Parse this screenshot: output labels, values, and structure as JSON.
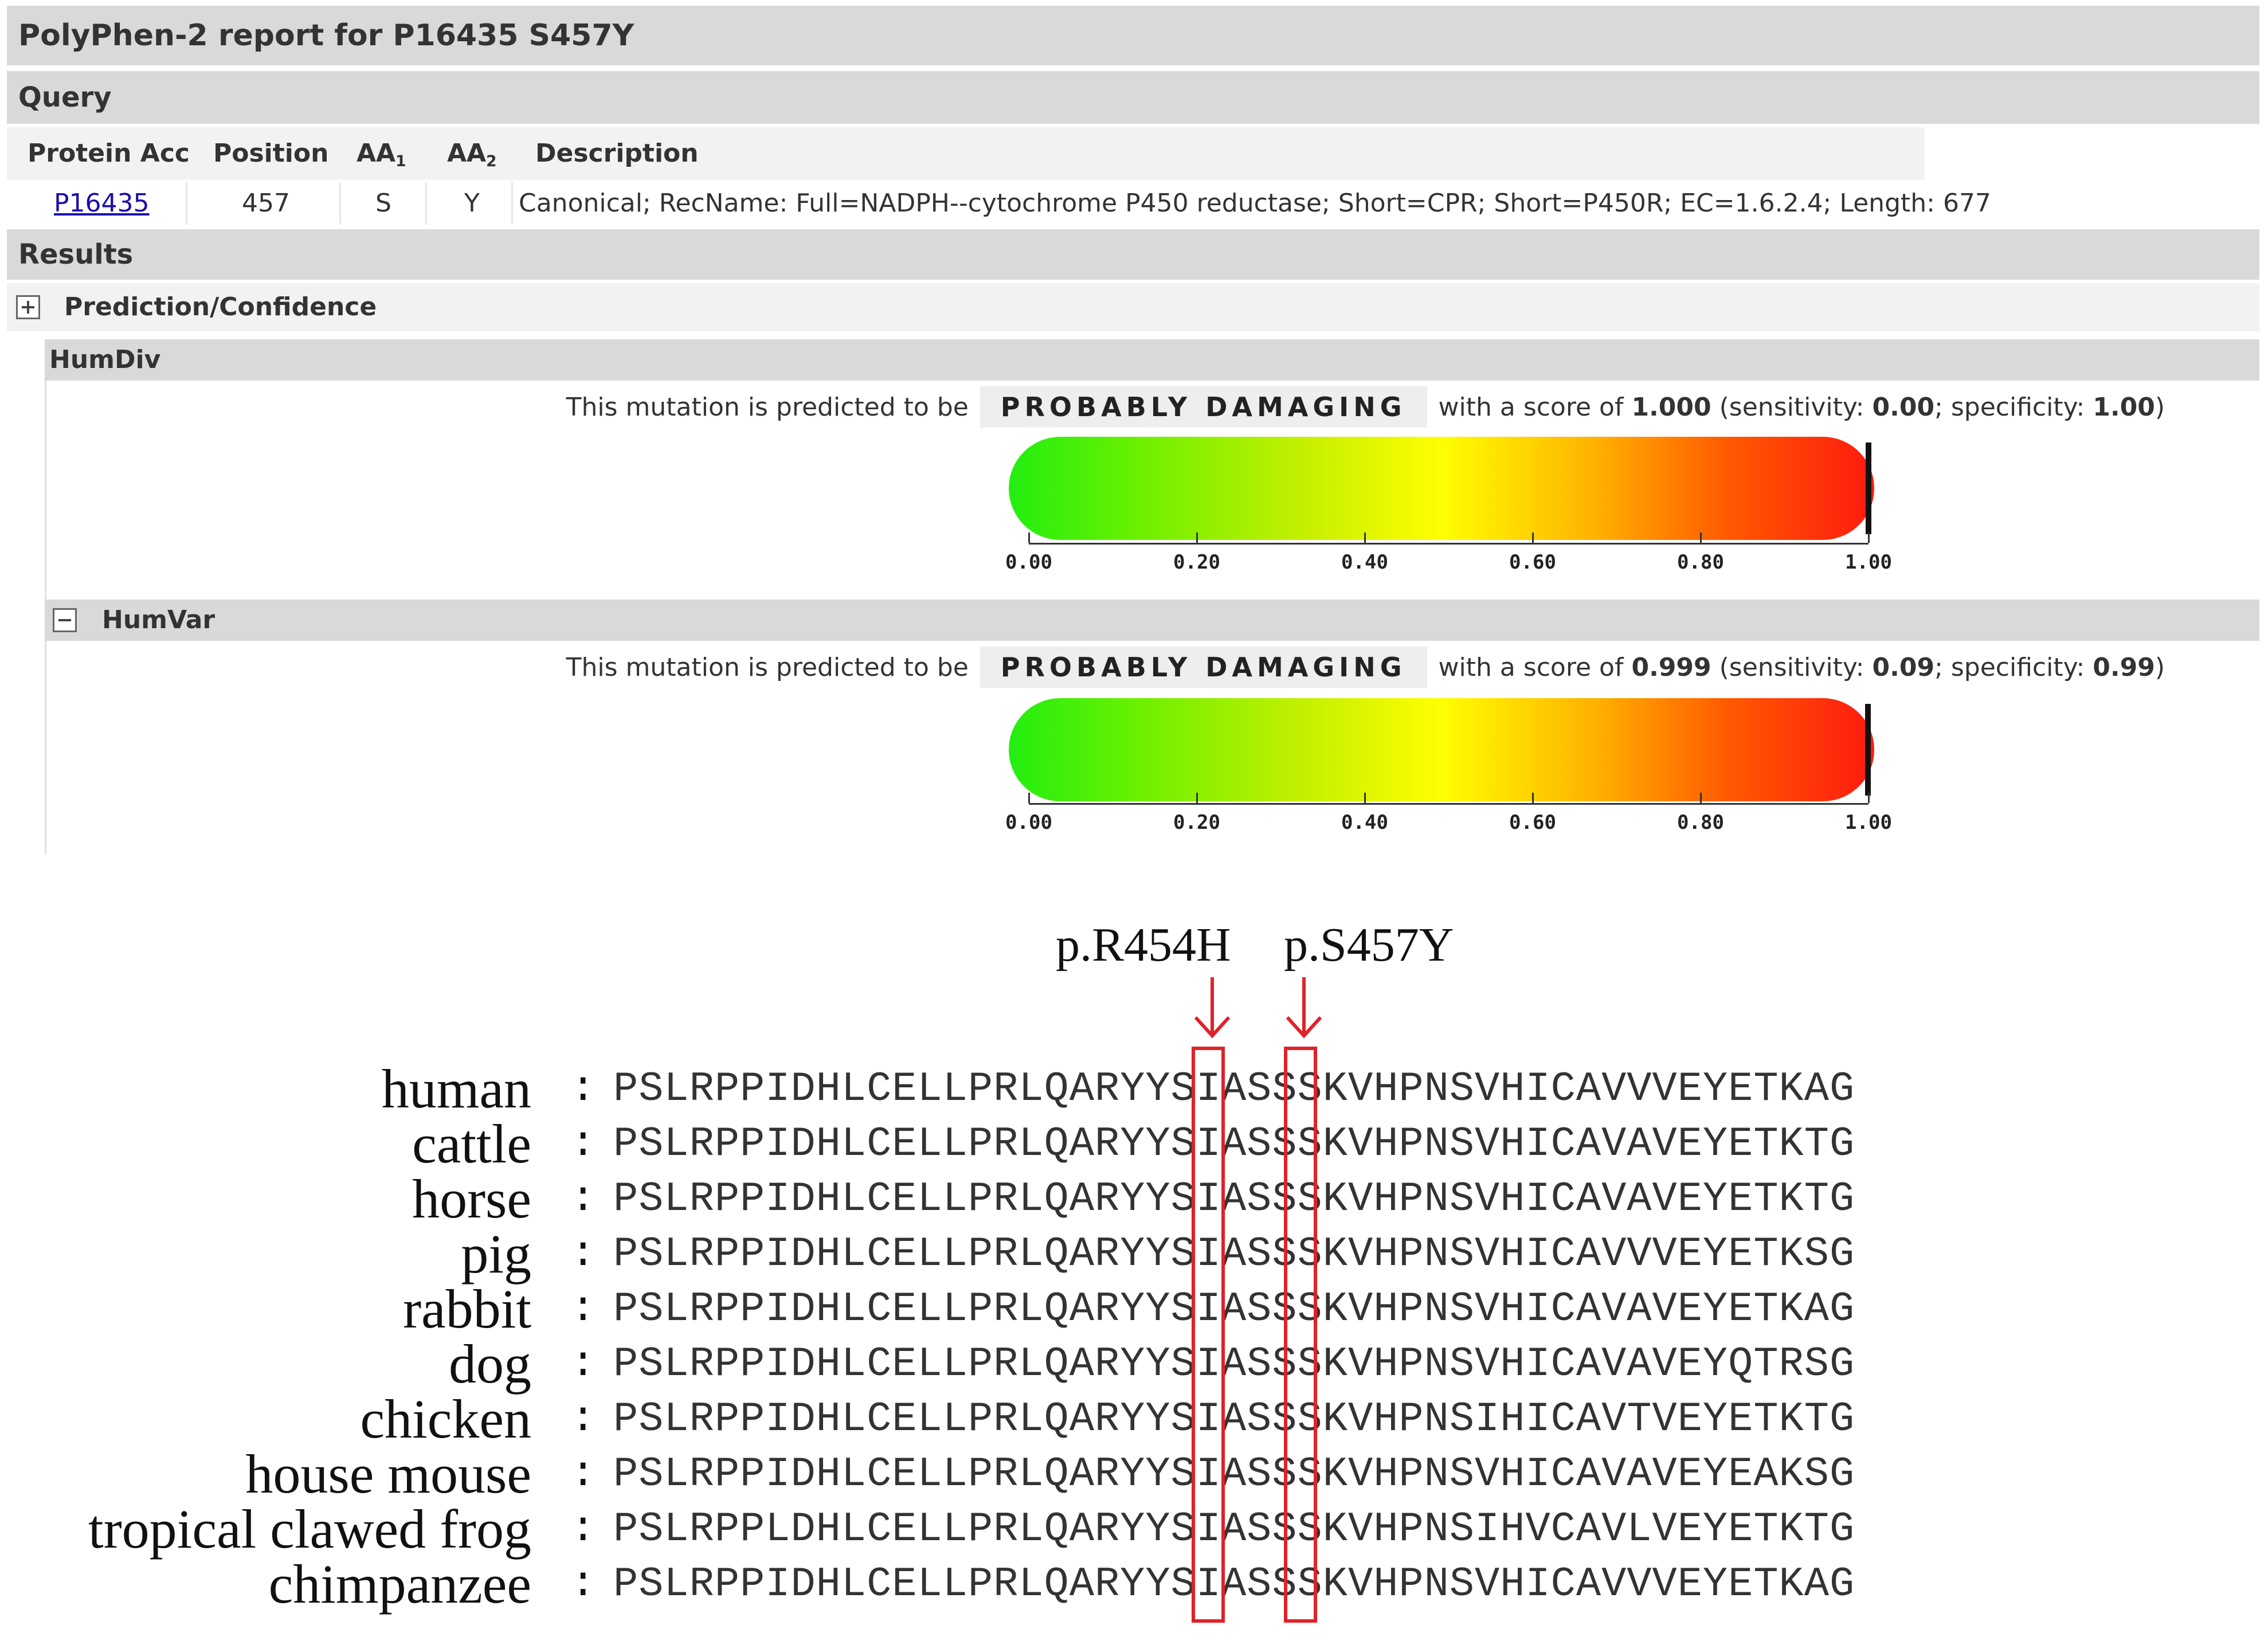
{
  "report_title": "PolyPhen-2 report for P16435 S457Y",
  "query": {
    "section_label": "Query",
    "headers": {
      "protein_acc": "Protein Acc",
      "position": "Position",
      "aa1": "AA",
      "aa1_sub": "1",
      "aa2": "AA",
      "aa2_sub": "2",
      "description": "Description"
    },
    "row": {
      "protein_acc": "P16435",
      "position": "457",
      "aa1": "S",
      "aa2": "Y",
      "description": "Canonical; RecName: Full=NADPH--cytochrome P450 reductase; Short=CPR; Short=P450R; EC=1.6.2.4; Length: 677"
    }
  },
  "results": {
    "section_label": "Results",
    "prediction_confidence_label": "Prediction/Confidence",
    "humdiv": {
      "label": "HumDiv",
      "prefix": "This mutation is predicted to be",
      "verdict": "PROBABLY DAMAGING",
      "score_text": "with a score of",
      "score": "1.000",
      "sens_text": "(sensitivity:",
      "sensitivity": "0.00",
      "spec_text": "; specificity:",
      "specificity": "1.00",
      "close": ")",
      "score_value": 1.0
    },
    "humvar": {
      "label": "HumVar",
      "prefix": "This mutation is predicted to be",
      "verdict": "PROBABLY DAMAGING",
      "score_text": "with a score of",
      "score": "0.999",
      "sens_text": "(sensitivity:",
      "sensitivity": "0.09",
      "spec_text": "; specificity:",
      "specificity": "0.99",
      "close": ")",
      "score_value": 0.999
    },
    "scale_ticks": [
      "0.00",
      "0.20",
      "0.40",
      "0.60",
      "0.80",
      "1.00"
    ],
    "gauge_colors": [
      "#22ee11",
      "#ffff00",
      "#ff1a10"
    ],
    "marker_color": "#111111"
  },
  "alignment": {
    "mutation_labels": [
      "p.R454H",
      "p.S457Y"
    ],
    "highlight_color": "#e0222a",
    "separator": ":",
    "rows": [
      {
        "species": "human",
        "seq": "PSLRPPIDHLCELLPRLQARYYSIASSSKVHPNSVHICAVVVEYETKAG"
      },
      {
        "species": "cattle",
        "seq": "PSLRPPIDHLCELLPRLQARYYSIASSSKVHPNSVHICAVAVEYETKTG"
      },
      {
        "species": "horse",
        "seq": "PSLRPPIDHLCELLPRLQARYYSIASSSKVHPNSVHICAVAVEYETKTG"
      },
      {
        "species": "pig",
        "seq": "PSLRPPIDHLCELLPRLQARYYSIASSSKVHPNSVHICAVVVEYETKSG"
      },
      {
        "species": "rabbit",
        "seq": "PSLRPPIDHLCELLPRLQARYYSIASSSKVHPNSVHICAVAVEYETKAG"
      },
      {
        "species": "dog",
        "seq": "PSLRPPIDHLCELLPRLQARYYSIASSSKVHPNSVHICAVAVEYQTRSG"
      },
      {
        "species": "chicken",
        "seq": "PSLRPPIDHLCELLPRLQARYYSIASSSKVHPNSIHICAVTVEYETKTG"
      },
      {
        "species": "house mouse",
        "seq": "PSLRPPIDHLCELLPRLQARYYSIASSSKVHPNSVHICAVAVEYEAKSG"
      },
      {
        "species": "tropical clawed frog",
        "seq": "PSLRPPLDHLCELLPRLQARYYSIASSSKVHPNSIHVCAVLVEYETKTG"
      },
      {
        "species": "chimpanzee",
        "seq": "PSLRPPIDHLCELLPRLQARYYSIASSSKVHPNSVHICAVVVEYETKAG"
      }
    ]
  }
}
